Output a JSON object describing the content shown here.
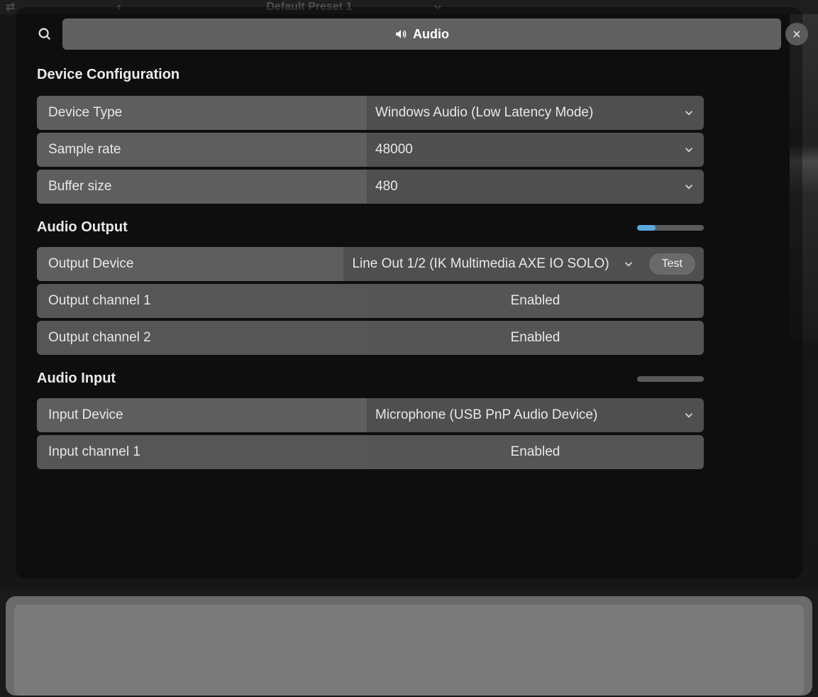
{
  "background": {
    "preset_label": "Default Preset 1"
  },
  "modal": {
    "title": "Audio",
    "sections": {
      "device_config": {
        "title": "Device Configuration",
        "rows": {
          "device_type": {
            "label": "Device Type",
            "value": "Windows Audio (Low Latency Mode)"
          },
          "sample_rate": {
            "label": "Sample rate",
            "value": "48000"
          },
          "buffer_size": {
            "label": "Buffer size",
            "value": "480"
          }
        }
      },
      "audio_output": {
        "title": "Audio Output",
        "meter_percent": 28,
        "rows": {
          "output_device": {
            "label": "Output Device",
            "value": "Line Out 1/2 (IK Multimedia AXE IO SOLO)",
            "test_label": "Test"
          },
          "output_ch1": {
            "label": "Output channel 1",
            "value": "Enabled"
          },
          "output_ch2": {
            "label": "Output channel 2",
            "value": "Enabled"
          }
        }
      },
      "audio_input": {
        "title": "Audio Input",
        "meter_percent": 0,
        "rows": {
          "input_device": {
            "label": "Input Device",
            "value": "Microphone (USB PnP Audio Device)"
          },
          "input_ch1": {
            "label": "Input channel 1",
            "value": "Enabled"
          }
        }
      }
    }
  }
}
